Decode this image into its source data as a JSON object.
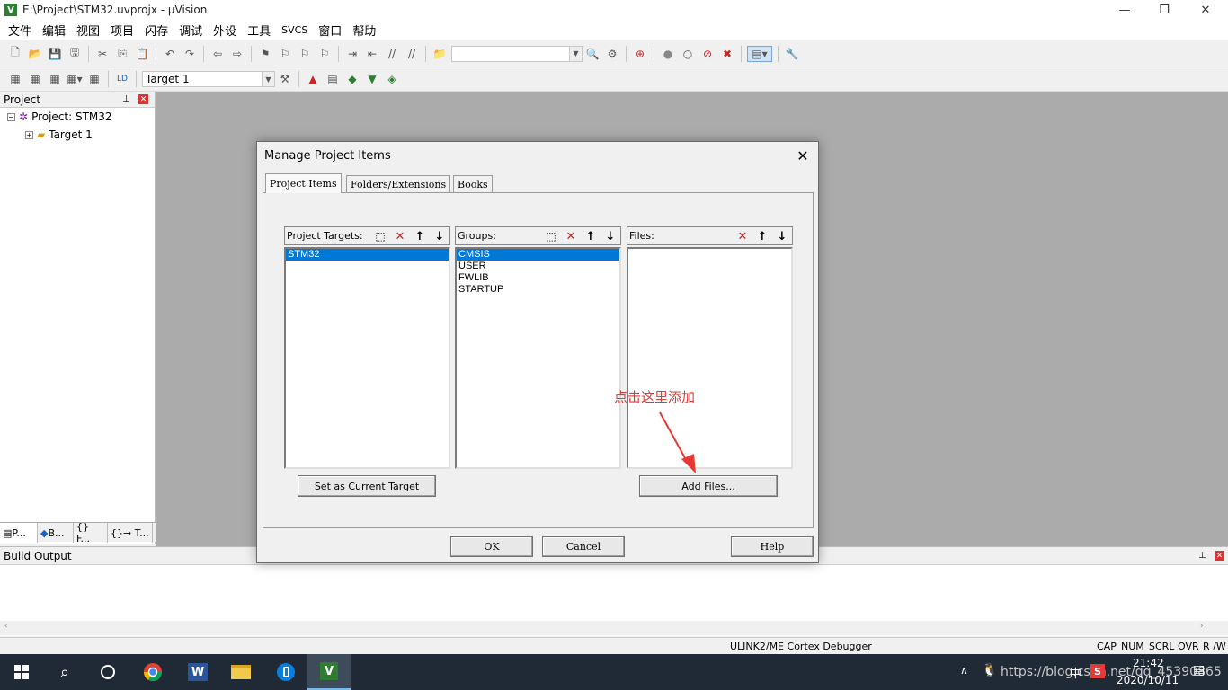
{
  "window": {
    "title": "E:\\Project\\STM32.uvprojx - µVision",
    "app_icon": "V",
    "minimize": "—",
    "restore": "❐",
    "close": "✕"
  },
  "menu": [
    "文件",
    "编辑",
    "视图",
    "项目",
    "闪存",
    "调试",
    "外设",
    "工具",
    "SVCS",
    "窗口",
    "帮助"
  ],
  "toolbar2": {
    "target_select": "Target 1"
  },
  "project_panel": {
    "title": "Project",
    "root": "Project: STM32",
    "child": "Target 1",
    "tabs": [
      "P...",
      "B...",
      "{} F...",
      "{}→ T..."
    ]
  },
  "build_output": {
    "title": "Build Output"
  },
  "statusbar": {
    "debugger": "ULINK2/ME Cortex Debugger",
    "indicators": [
      "CAP",
      "NUM",
      "SCRL",
      "OVR",
      "R /W"
    ]
  },
  "dialog": {
    "title": "Manage Project Items",
    "tabs": [
      "Project Items",
      "Folders/Extensions",
      "Books"
    ],
    "targets": {
      "label": "Project Targets:",
      "items": [
        "STM32"
      ],
      "selected": 0
    },
    "groups": {
      "label": "Groups:",
      "items": [
        "CMSIS",
        "USER",
        "FWLIB",
        "STARTUP"
      ],
      "selected": 0
    },
    "files": {
      "label": "Files:",
      "items": []
    },
    "set_target_button": "Set as Current Target",
    "add_files_button": "Add Files...",
    "ok_button": "OK",
    "cancel_button": "Cancel",
    "help_button": "Help"
  },
  "annotation": {
    "text": "点击这里添加",
    "color": "#e53935"
  },
  "taskbar": {
    "time": "21:42",
    "date": "2020/10/11",
    "watermark": "https://blog.csdn.net/qq_45390865",
    "ime": "中"
  },
  "colors": {
    "selection": "#0078d7",
    "workspace": "#ababab",
    "taskbar": "#1f2a36"
  }
}
